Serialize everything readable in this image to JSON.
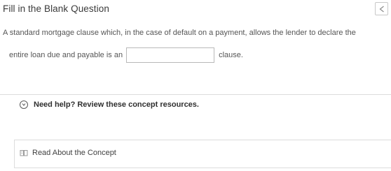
{
  "header": {
    "title": "Fill in the Blank Question",
    "audio_icon": "speaker-icon"
  },
  "question": {
    "text_before": "A standard mortgage clause which, in the case of default on a payment, allows the lender to declare the",
    "text_line2_before": "entire loan due and payable is an",
    "blank_value": "",
    "text_after": "clause."
  },
  "help": {
    "toggle_icon": "chevron-circle-icon",
    "label": "Need help? Review these concept resources."
  },
  "resources": [
    {
      "icon": "book-icon",
      "label": "Read About the Concept"
    }
  ]
}
